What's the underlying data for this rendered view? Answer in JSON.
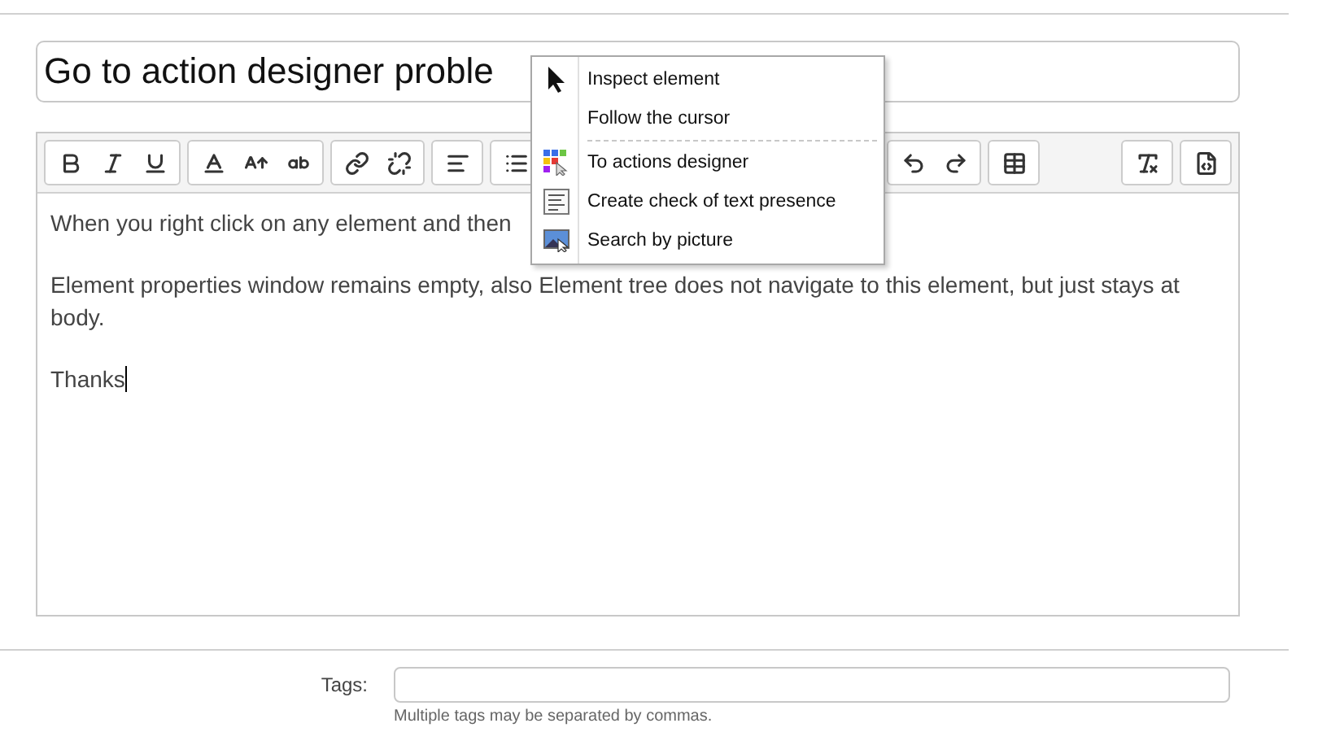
{
  "title_field": {
    "value": "Go to action designer proble"
  },
  "toolbar": {
    "groups": [
      {
        "buttons": [
          {
            "kind": "bold"
          },
          {
            "kind": "italic"
          },
          {
            "kind": "underline"
          }
        ]
      },
      {
        "buttons": [
          {
            "kind": "text-color"
          },
          {
            "kind": "font-size"
          },
          {
            "kind": "smaller"
          }
        ]
      },
      {
        "buttons": [
          {
            "kind": "link"
          },
          {
            "kind": "unlink"
          }
        ]
      },
      {
        "buttons": [
          {
            "kind": "align-left"
          }
        ]
      },
      {
        "buttons": [
          {
            "kind": "list"
          },
          {
            "kind": "hidden"
          },
          {
            "kind": "hidden"
          },
          {
            "kind": "hidden"
          },
          {
            "kind": "hidden"
          },
          {
            "kind": "hidden"
          },
          {
            "kind": "hidden"
          },
          {
            "kind": "hidden"
          },
          {
            "kind": "hidden"
          }
        ]
      },
      {
        "buttons": [
          {
            "kind": "undo"
          },
          {
            "kind": "redo"
          }
        ]
      },
      {
        "buttons": [
          {
            "kind": "table"
          }
        ]
      }
    ],
    "right_groups": [
      {
        "buttons": [
          {
            "kind": "remove-format"
          }
        ]
      },
      {
        "buttons": [
          {
            "kind": "source"
          }
        ]
      }
    ]
  },
  "editor": {
    "paragraphs": [
      "When you right click on any element and then",
      "Element properties window remains empty, also Element tree does not navigate to this element, but just stays at body.",
      "Thanks"
    ]
  },
  "context_menu": {
    "items": [
      {
        "kind": "arrow",
        "label": "Inspect element"
      },
      {
        "kind": "none",
        "label": "Follow the cursor",
        "separator_after": true
      },
      {
        "kind": "grid",
        "label": "To actions designer"
      },
      {
        "kind": "text",
        "label": "Create check of text presence"
      },
      {
        "kind": "image",
        "label": "Search by picture"
      }
    ]
  },
  "tags": {
    "label": "Tags:",
    "hint": "Multiple tags may be separated by commas."
  }
}
